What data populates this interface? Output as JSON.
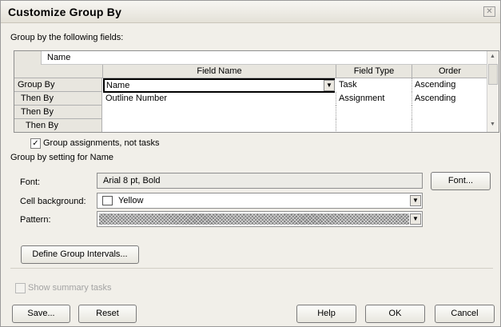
{
  "dialog": {
    "title": "Customize Group By",
    "close_symbol": "✕"
  },
  "group_by_label": "Group by the following fields:",
  "grid": {
    "name_bar": "Name",
    "headers": {
      "field_name": "Field Name",
      "field_type": "Field Type",
      "order": "Order"
    },
    "rows": [
      {
        "label": "Group By",
        "field_name": "Name",
        "field_type": "Task",
        "order": "Ascending"
      },
      {
        "label": "Then By",
        "field_name": "Outline Number",
        "field_type": "Assignment",
        "order": "Ascending"
      },
      {
        "label": "Then By",
        "field_name": "",
        "field_type": "",
        "order": ""
      },
      {
        "label": "Then By",
        "field_name": "",
        "field_type": "",
        "order": ""
      }
    ]
  },
  "group_assignments": {
    "label": "Group assignments, not tasks",
    "checked": true
  },
  "setting_label": "Group by setting for Name",
  "font": {
    "label": "Font:",
    "value": "Arial 8 pt, Bold",
    "button": "Font..."
  },
  "cell_background": {
    "label": "Cell background:",
    "value": "Yellow"
  },
  "pattern": {
    "label": "Pattern:"
  },
  "define_intervals_button": "Define Group Intervals...",
  "show_summary": {
    "label": "Show summary tasks",
    "checked": false
  },
  "buttons": {
    "save": "Save...",
    "reset": "Reset",
    "help": "Help",
    "ok": "OK",
    "cancel": "Cancel"
  },
  "colors": {
    "dialog_bg": "#f1efe9",
    "header_bg": "#e8e6df"
  }
}
